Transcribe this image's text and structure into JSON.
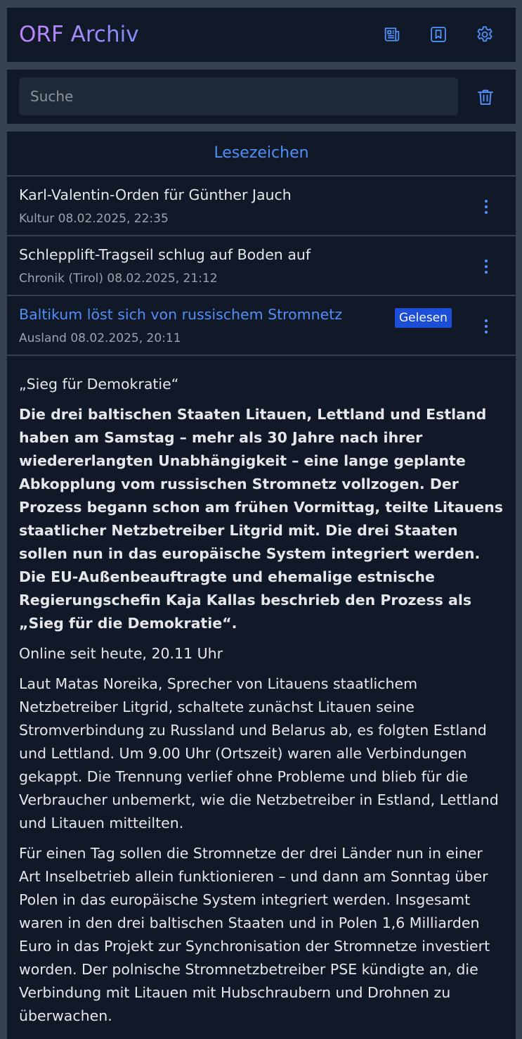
{
  "header": {
    "brand_prefix": "ORF",
    "brand_suffix": " Archiv",
    "icons": [
      "news-icon",
      "bookmark-icon",
      "gear-icon"
    ],
    "accent": "#4f8ff7"
  },
  "search": {
    "placeholder": "Suche",
    "value": ""
  },
  "bookmarks": {
    "title": "Lesezeichen",
    "items": [
      {
        "title": "Karl-Valentin-Orden für Günther Jauch",
        "meta": "Kultur 08.02.2025, 22:35",
        "read": false
      },
      {
        "title": "Schlepplift-Tragseil schlug auf Boden auf",
        "meta": "Chronik (Tirol) 08.02.2025, 21:12",
        "read": false
      },
      {
        "title": "Baltikum löst sich von russischem Stromnetz",
        "meta": "Ausland 08.02.2025, 20:11",
        "read": true,
        "badge": "Gelesen"
      }
    ]
  },
  "article": {
    "kicker": "„Sieg für Demokratie“",
    "lead": "Die drei baltischen Staaten Litauen, Lettland und Estland haben am Samstag – mehr als 30 Jahre nach ihrer wiedererlangten Unabhängigkeit – eine lange geplante Abkopplung vom russischen Stromnetz vollzogen. Der Prozess begann schon am frühen Vormittag, teilte Litauens staatlicher Netzbetreiber Litgrid mit. Die drei Staaten sollen nun in das europäische System integriert werden. Die EU-Außenbeauftragte und ehemalige estnische Regierungschefin Kaja Kallas beschrieb den Prozess als „Sieg für die Demokratie“.",
    "online": "Online seit heute, 20.11 Uhr",
    "paragraphs": [
      "Laut Matas Noreika, Sprecher von Litauens staatlichem Netzbetreiber Litgrid, schaltete zunächst Litauen seine Stromverbindung zu Russland und Belarus ab, es folgten Estland und Lettland. Um 9.00 Uhr (Ortszeit) waren alle Verbindungen gekappt. Die Trennung verlief ohne Probleme und blieb für die Verbraucher unbemerkt, wie die Netzbetreiber in Estland, Lettland und Litauen mitteilten.",
      "Für einen Tag sollen die Stromnetze der drei Länder nun in einer Art Inselbetrieb allein funktionieren – und dann am Sonntag über Polen in das europäische System integriert werden. Insgesamt waren in den drei baltischen Staaten und in Polen 1,6 Milliarden Euro in das Projekt zur Synchronisation der Stromnetze investiert worden. Der polnische Stromnetzbetreiber PSE kündigte an, die Verbindung mit Litauen mit Hubschraubern und Drohnen zu überwachen."
    ]
  }
}
